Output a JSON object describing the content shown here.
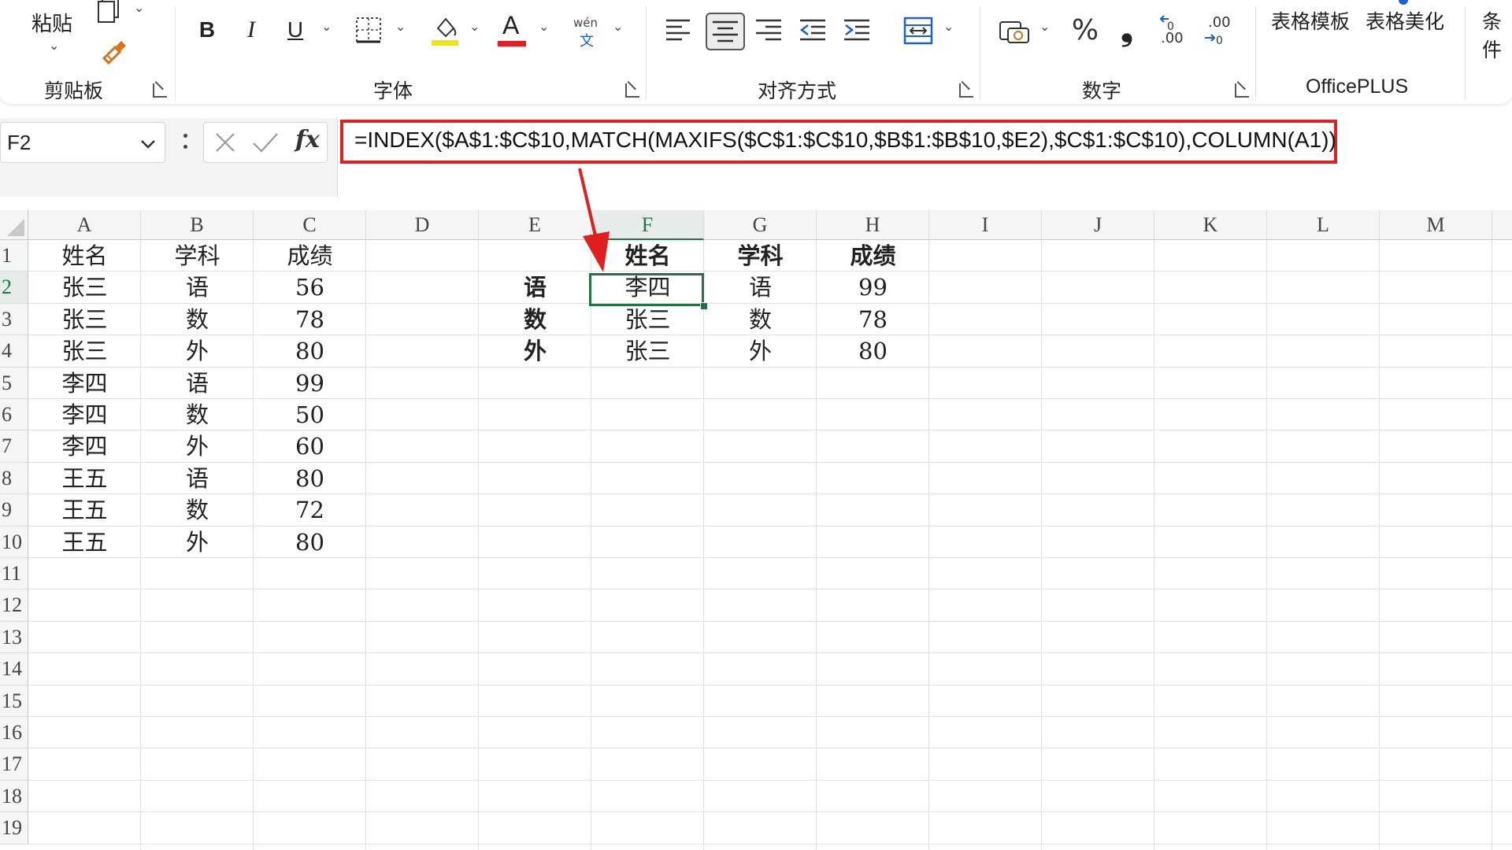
{
  "ribbon": {
    "clipboard": {
      "paste_label": "粘贴",
      "group_label": "剪贴板"
    },
    "font": {
      "bold": "B",
      "italic": "I",
      "underline": "U",
      "font_color_letter": "A",
      "phonetic_top": "wén",
      "phonetic_bottom": "文",
      "group_label": "字体"
    },
    "alignment": {
      "group_label": "对齐方式"
    },
    "number": {
      "percent": "%",
      "comma": "❟",
      "inc_decimal": ".00",
      "dec_decimal": ".00",
      "group_label": "数字"
    },
    "officeplus": {
      "template_label": "表格模板",
      "beautify_label": "表格美化",
      "group_label": "OfficePLUS",
      "cut_label": "条件"
    },
    "colors": {
      "fill_yellow": "#f5e400",
      "font_red": "#e51c23",
      "accent_blue": "#1a5fd0"
    }
  },
  "formula_bar": {
    "name_box": "F2",
    "fx_label": "fx",
    "formula": "=INDEX($A$1:$C$10,MATCH(MAXIFS($C$1:$C$10,$B$1:$B$10,$E2),$C$1:$C$10),COLUMN(A1))"
  },
  "sheet": {
    "columns": [
      "A",
      "B",
      "C",
      "D",
      "E",
      "F",
      "G",
      "H",
      "I",
      "J",
      "K",
      "L",
      "M"
    ],
    "rows": [
      "1",
      "2",
      "3",
      "4",
      "5",
      "6",
      "7",
      "8",
      "9",
      "10",
      "11",
      "12",
      "13",
      "14",
      "15",
      "16",
      "17",
      "18",
      "19"
    ],
    "active_cell": "F2",
    "cells": {
      "A1": "姓名",
      "B1": "学科",
      "C1": "成绩",
      "A2": "张三",
      "B2": "语",
      "C2": "56",
      "A3": "张三",
      "B3": "数",
      "C3": "78",
      "A4": "张三",
      "B4": "外",
      "C4": "80",
      "A5": "李四",
      "B5": "语",
      "C5": "99",
      "A6": "李四",
      "B6": "数",
      "C6": "50",
      "A7": "李四",
      "B7": "外",
      "C7": "60",
      "A8": "王五",
      "B8": "语",
      "C8": "80",
      "A9": "王五",
      "B9": "数",
      "C9": "72",
      "A10": "王五",
      "B10": "外",
      "C10": "80",
      "F1": "姓名",
      "G1": "学科",
      "H1": "成绩",
      "E2": "语",
      "F2": "李四",
      "G2": "语",
      "H2": "99",
      "E3": "数",
      "F3": "张三",
      "G3": "数",
      "H3": "78",
      "E4": "外",
      "F4": "张三",
      "G4": "外",
      "H4": "80"
    },
    "colors": {
      "active_green": "#217346",
      "highlight_red": "#e02020"
    }
  }
}
